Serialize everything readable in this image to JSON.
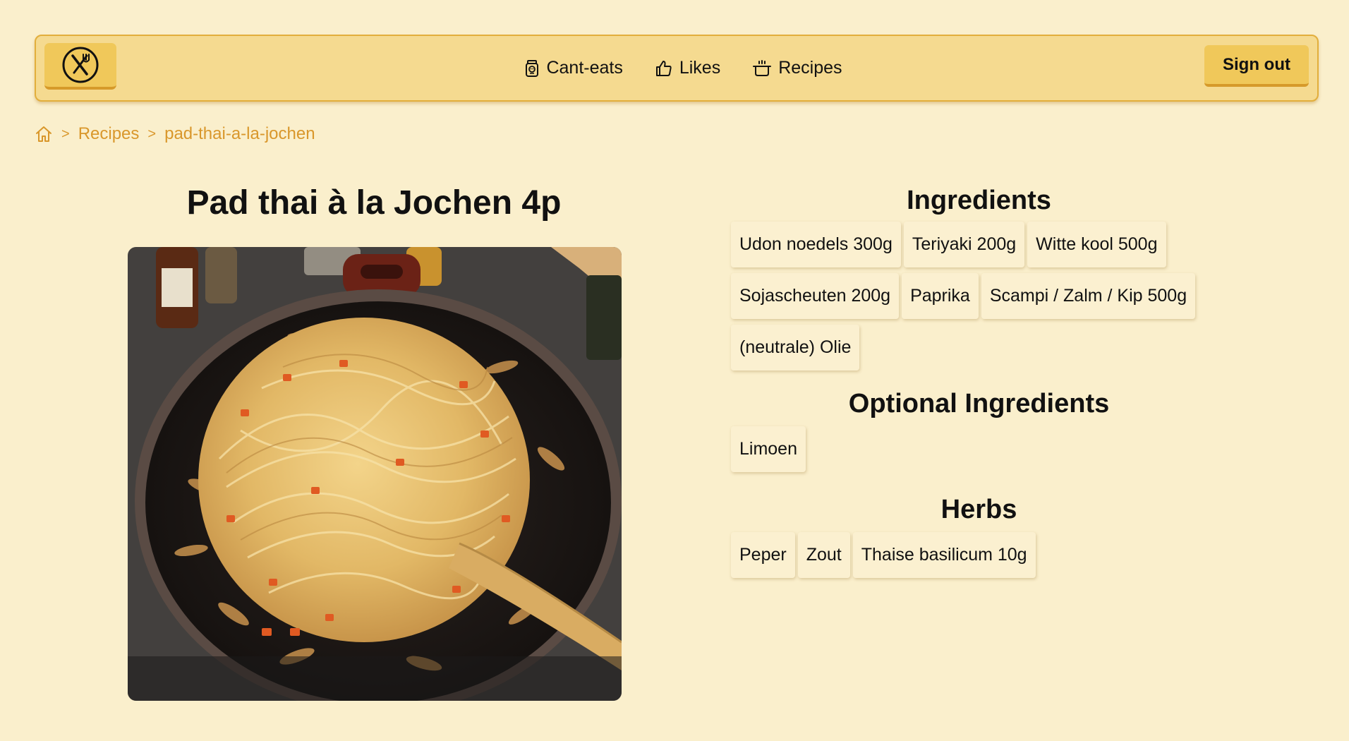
{
  "header": {
    "logo_icon": "fork-knife-logo-icon",
    "nav": [
      {
        "label": "Cant-eats",
        "icon": "skull-jar-icon"
      },
      {
        "label": "Likes",
        "icon": "thumbs-up-icon"
      },
      {
        "label": "Recipes",
        "icon": "cooking-pot-icon"
      }
    ],
    "signout_label": "Sign out"
  },
  "breadcrumb": {
    "home_icon": "home-icon",
    "separator": ">",
    "items": [
      "Recipes",
      "pad-thai-a-la-jochen"
    ]
  },
  "recipe": {
    "title": "Pad thai à la Jochen 4p"
  },
  "ingredients": {
    "title": "Ingredients",
    "items": [
      "Udon noedels 300g",
      "Teriyaki 200g",
      "Witte kool 500g",
      "Sojascheuten 200g",
      "Paprika",
      "Scampi / Zalm / Kip 500g",
      "(neutrale) Olie"
    ]
  },
  "optional": {
    "title": "Optional Ingredients",
    "items": [
      "Limoen"
    ]
  },
  "herbs": {
    "title": "Herbs",
    "items": [
      "Peper",
      "Zout",
      "Thaise basilicum 10g"
    ]
  },
  "colors": {
    "background": "#faefcc",
    "header_bg": "#f5da90",
    "button_bg": "#f0c85a",
    "accent": "#d9972b"
  }
}
